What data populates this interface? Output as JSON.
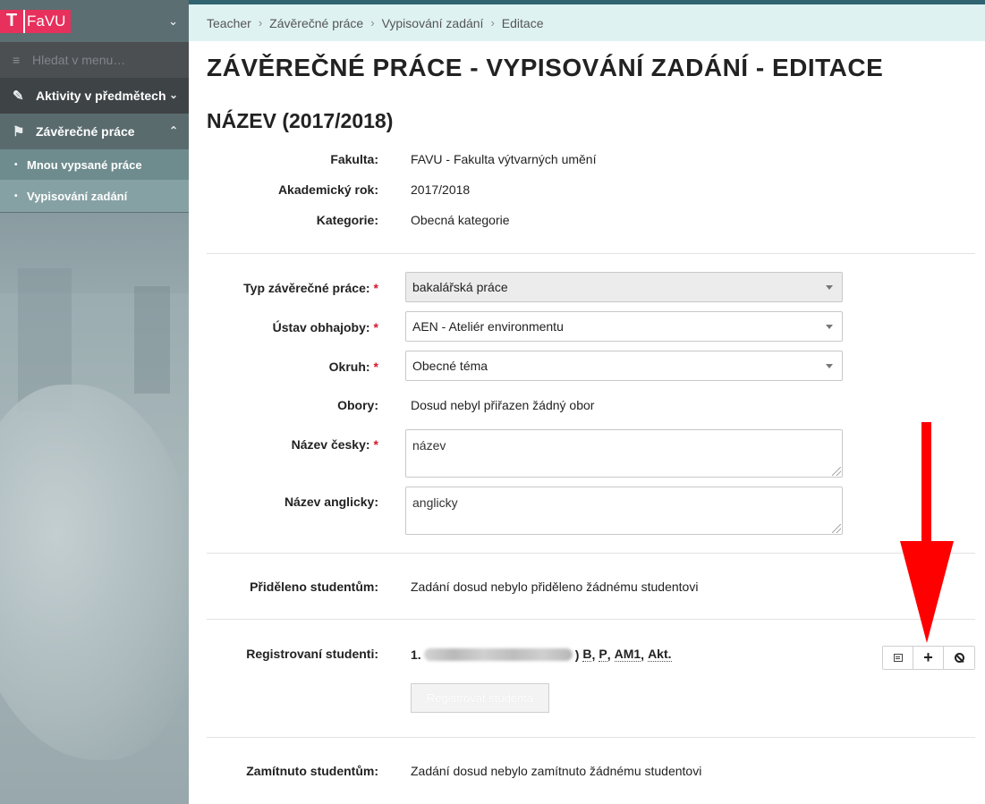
{
  "sidebar": {
    "logo_letter": "T",
    "logo_text": "FaVU",
    "search_placeholder": "Hledat v menu…",
    "menu": [
      {
        "label": "Aktivity v předmětech",
        "icon": "edit-icon"
      },
      {
        "label": "Závěrečné práce",
        "icon": "checkered-flag-icon"
      }
    ],
    "submenu": [
      {
        "label": "Mnou vypsané práce"
      },
      {
        "label": "Vypisování zadání"
      }
    ]
  },
  "breadcrumb": [
    "Teacher",
    "Závěrečné práce",
    "Vypisování zadání",
    "Editace"
  ],
  "page_title": "ZÁVĚREČNÉ PRÁCE - VYPISOVÁNÍ ZADÁNÍ - EDITACE",
  "subtitle": "NÁZEV (2017/2018)",
  "info": {
    "fakulta_label": "Fakulta:",
    "fakulta_value": "FAVU - Fakulta výtvarných umění",
    "rok_label": "Akademický rok:",
    "rok_value": "2017/2018",
    "kategorie_label": "Kategorie:",
    "kategorie_value": "Obecná kategorie"
  },
  "form": {
    "typ_label": "Typ závěrečné práce:",
    "typ_value": "bakalářská práce",
    "ustav_label": "Ústav obhajoby:",
    "ustav_value": "AEN - Ateliér environmentu",
    "okruh_label": "Okruh:",
    "okruh_value": "Obecné téma",
    "obory_label": "Obory:",
    "obory_value": "Dosud nebyl přiřazen žádný obor",
    "nazev_cz_label": "Název česky:",
    "nazev_cz_value": "název",
    "nazev_en_label": "Název anglicky:",
    "nazev_en_value": "anglicky",
    "required_mark": "*"
  },
  "assigned": {
    "label": "Přiděleno studentům:",
    "value": "Zadání dosud nebylo přiděleno žádnému studentovi"
  },
  "registered": {
    "label": "Registrovaní studenti:",
    "index": "1.",
    "closing": ")",
    "tags": [
      "B",
      "P",
      "AM1",
      "Akt."
    ],
    "register_button": "Registrovat studenta"
  },
  "rejected": {
    "label": "Zamítnuto studentům:",
    "value": "Zadání dosud nebylo zamítnuto žádnému studentovi"
  },
  "colors": {
    "accent_pink": "#e7305c",
    "breadcrumb_bg": "#dff2f2",
    "required": "#d9162b",
    "annotation_arrow": "#ff0000"
  }
}
